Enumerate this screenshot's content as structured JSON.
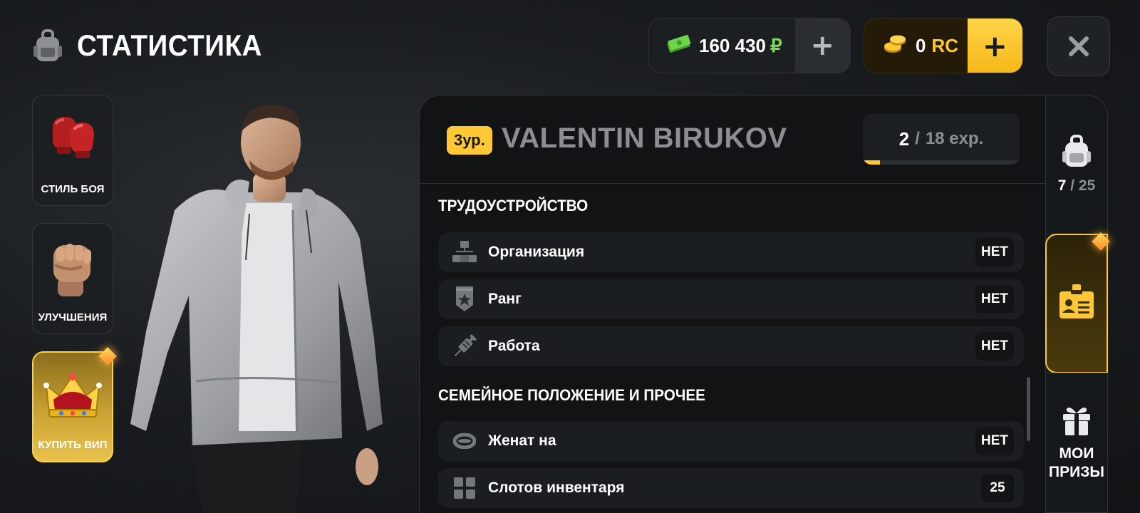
{
  "header": {
    "title": "СТАТИСТИКА",
    "title_icon": "backpack-icon"
  },
  "currency": {
    "money_value": "160 430",
    "money_symbol": "₽",
    "money_plus": "+",
    "rc_value": "0",
    "rc_unit": "RC",
    "rc_plus": "+"
  },
  "left_menu": [
    {
      "label": "СТИЛЬ БОЯ",
      "icon": "boxing-gloves-icon"
    },
    {
      "label": "УЛУЧШЕНИЯ",
      "icon": "fist-icon"
    },
    {
      "label": "КУПИТЬ ВИП",
      "icon": "crown-icon"
    }
  ],
  "profile": {
    "level_badge": "3ур.",
    "name": "VALENTIN BIRUKOV",
    "exp_current": "2",
    "exp_sep": "/",
    "exp_total": "18 exp.",
    "exp_progress": 0.11
  },
  "sections": [
    {
      "title": "ТРУДОУСТРОЙСТВО",
      "rows": [
        {
          "label": "Организация",
          "value": "НЕТ",
          "icon": "organization-icon"
        },
        {
          "label": "Ранг",
          "value": "НЕТ",
          "icon": "rank-badge-icon"
        },
        {
          "label": "Работа",
          "value": "НЕТ",
          "icon": "syringe-icon"
        }
      ]
    },
    {
      "title": "СЕМЕЙНОЕ ПОЛОЖЕНИЕ И ПРОЧЕЕ",
      "rows": [
        {
          "label": "Женат на",
          "value": "НЕТ",
          "icon": "ring-icon"
        },
        {
          "label": "Слотов инвентаря",
          "value": "25",
          "icon": "inventory-grid-icon"
        }
      ]
    }
  ],
  "right_tabs": {
    "inventory_count": "7",
    "inventory_sep": "/",
    "inventory_total": "25",
    "prizes_label_1": "МОИ",
    "prizes_label_2": "ПРИЗЫ"
  },
  "colors": {
    "accent": "#ffc834",
    "money_green": "#7ed957",
    "background": "#1a1d20"
  }
}
